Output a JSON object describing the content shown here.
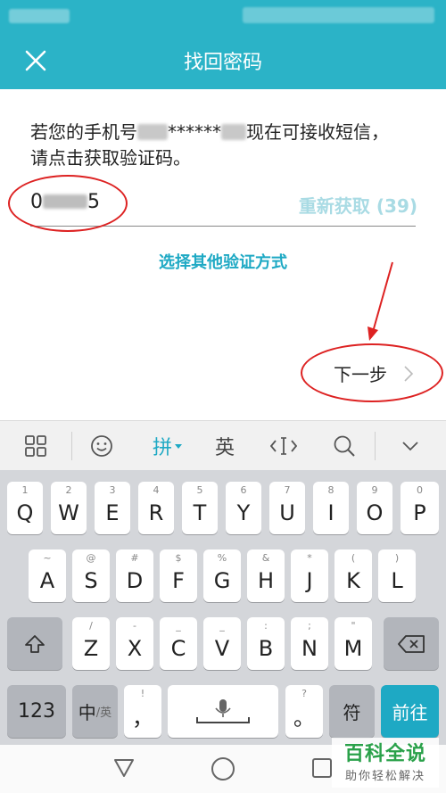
{
  "header": {
    "title": "找回密码",
    "close_icon": "close-icon"
  },
  "prompt": {
    "part1": "若您的手机号",
    "masked": "******",
    "part2": "现在可接收短信，请点击获取验证码。"
  },
  "code": {
    "prefix": "0",
    "suffix": "5"
  },
  "resend_label": "重新获取 (39)",
  "other_method_label": "选择其他验证方式",
  "next_label": "下一步",
  "keyboard": {
    "toolbar": {
      "pinyin": "拼",
      "english": "英"
    },
    "row1": [
      {
        "sub": "1",
        "main": "Q"
      },
      {
        "sub": "2",
        "main": "W"
      },
      {
        "sub": "3",
        "main": "E"
      },
      {
        "sub": "4",
        "main": "R"
      },
      {
        "sub": "5",
        "main": "T"
      },
      {
        "sub": "6",
        "main": "Y"
      },
      {
        "sub": "7",
        "main": "U"
      },
      {
        "sub": "8",
        "main": "I"
      },
      {
        "sub": "9",
        "main": "O"
      },
      {
        "sub": "0",
        "main": "P"
      }
    ],
    "row2": [
      {
        "sub": "~",
        "main": "A"
      },
      {
        "sub": "@",
        "main": "S"
      },
      {
        "sub": "#",
        "main": "D"
      },
      {
        "sub": "$",
        "main": "F"
      },
      {
        "sub": "%",
        "main": "G"
      },
      {
        "sub": "&",
        "main": "H"
      },
      {
        "sub": "*",
        "main": "J"
      },
      {
        "sub": "(",
        "main": "K"
      },
      {
        "sub": ")",
        "main": "L"
      }
    ],
    "row3": [
      {
        "sub": "/",
        "main": "Z"
      },
      {
        "sub": "-",
        "main": "X"
      },
      {
        "sub": "_",
        "main": "C"
      },
      {
        "sub": "_",
        "main": "V"
      },
      {
        "sub": ":",
        "main": "B"
      },
      {
        "sub": ";",
        "main": "N"
      },
      {
        "sub": "\"",
        "main": "M"
      }
    ],
    "row4": {
      "num": "123",
      "lang_main": "中",
      "lang_sub": "/英",
      "comma_sub": "!",
      "comma": "，",
      "period_sub": "?",
      "period": "。",
      "symbols": "符",
      "go": "前往"
    }
  },
  "watermark": {
    "title": "百科全说",
    "subtitle": "助你轻松解决"
  }
}
